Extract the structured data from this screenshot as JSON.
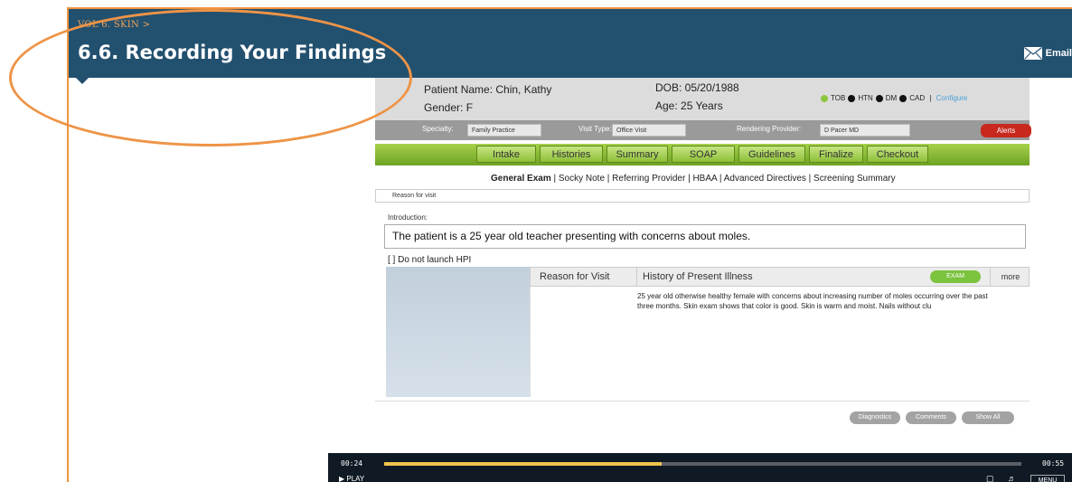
{
  "header": {
    "breadcrumb": "VOL 6. SKIN >",
    "title": "6.6. Recording Your Findings",
    "email_label": "Email"
  },
  "emr": {
    "patient_name": "Patient Name: Chin, Kathy",
    "gender": "Gender: F",
    "dob": "DOB: 05/20/1988",
    "age": "Age: 25 Years",
    "flags": [
      {
        "label": "TOB",
        "color": "#8dc63f"
      },
      {
        "label": "HTN",
        "color": "#111111"
      },
      {
        "label": "DM",
        "color": "#111111"
      },
      {
        "label": "CAD",
        "color": "#111111"
      }
    ],
    "configure_label": "Configure",
    "specialty_label": "Specialty:",
    "specialty_value": "Family Practice",
    "visit_type_label": "Visit Type:",
    "visit_type_value": "Office Visit",
    "provider_label": "Rendering Provider:",
    "provider_value": "D Pacer MD",
    "alerts_label": "Alerts",
    "tabs": [
      "Intake",
      "Histories",
      "Summary",
      "SOAP",
      "Guidelines",
      "Finalize",
      "Checkout"
    ],
    "sub_links": {
      "active": "General Exam",
      "rest": " |  Socky Note  |  Referring Provider  |   HBAA  |  Advanced Directives  |  Screening Summary"
    },
    "reason_bar": "Reason for visit",
    "intro_label": "Introduction:",
    "intro_text": "The patient is a 25 year old teacher presenting with concerns about moles.",
    "hpi_option": "[ ]    Do not launch HPI",
    "grid": {
      "col1": "Reason for Visit",
      "col2": "History of Present Illness",
      "exam_label": "EXAM",
      "more_label": "more",
      "hpi_text": "25 year old otherwise healthy female with concerns about increasing number of moles occurring over the past three months. Skin exam shows that color is good. Skin is warm and moist. Nails without clu"
    },
    "bottom_buttons": [
      "Diagnostics",
      "Comments",
      "Show All"
    ]
  },
  "player": {
    "current_time": "00:24",
    "duration": "00:55",
    "progress_fraction": 0.436,
    "play_label": "PLAY",
    "menu_label": "MENU"
  },
  "colors": {
    "header_bg": "#22506f",
    "accent_orange": "#f0943e",
    "tab_green": "#8dbf38",
    "progress_yellow": "#f0c44c"
  }
}
